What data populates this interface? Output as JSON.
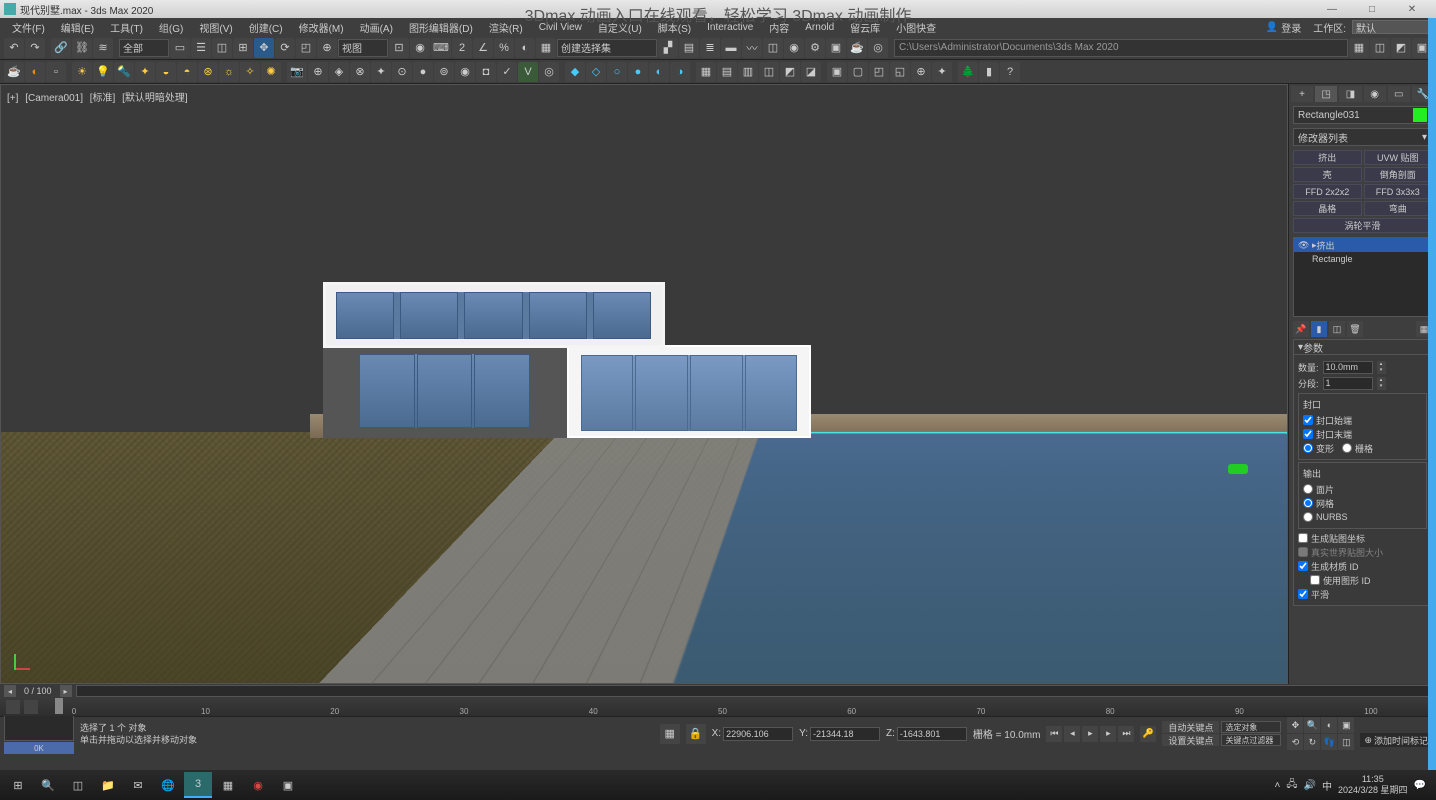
{
  "titlebar": {
    "filename": "现代别墅.max - 3ds Max 2020"
  },
  "overlay": "3Dmax 动画入口在线观看，轻松学习 3Dmax 动画制作",
  "menubar": {
    "items": [
      "文件(F)",
      "编辑(E)",
      "工具(T)",
      "组(G)",
      "视图(V)",
      "创建(C)",
      "修改器(M)",
      "动画(A)",
      "图形编辑器(D)",
      "渲染(R)",
      "Civil View",
      "自定义(U)",
      "脚本(S)",
      "Interactive",
      "内容",
      "Arnold",
      "留云库",
      "小图快查"
    ],
    "login": "登录",
    "workspace_label": "工作区:",
    "workspace_value": "默认"
  },
  "toolbar1": {
    "sel_filter": "全部",
    "view_mode": "视图",
    "path": "C:\\Users\\Administrator\\Documents\\3ds Max 2020"
  },
  "viewport": {
    "labels": [
      "[+]",
      "[Camera001]",
      "[标准]",
      "[默认明暗处理]"
    ]
  },
  "sidebar": {
    "object_name": "Rectangle031",
    "modifier_header": "修改器列表",
    "modifier_buttons": [
      {
        "l": "挤出",
        "r": "UVW 贴图"
      },
      {
        "l": "壳",
        "r": "倒角剖面"
      },
      {
        "l": "FFD 2x2x2",
        "r": "FFD 3x3x3"
      },
      {
        "l": "晶格",
        "r": "弯曲"
      }
    ],
    "modifier_single": "涡轮平滑",
    "stack": [
      {
        "name": "挤出",
        "selected": true
      },
      {
        "name": "Rectangle",
        "selected": false
      }
    ],
    "params_title": "参数",
    "amount_label": "数量:",
    "amount_value": "10.0mm",
    "segments_label": "分段:",
    "segments_value": "1",
    "cap_title": "封口",
    "cap_start": "封口始端",
    "cap_end": "封口末端",
    "morph": "变形",
    "grid": "栅格",
    "output_title": "输出",
    "patch": "面片",
    "mesh": "网格",
    "nurbs": "NURBS",
    "gen_map": "生成贴图坐标",
    "real_world": "真实世界贴图大小",
    "gen_mat_id": "生成材质 ID",
    "use_shape_id": "使用图形 ID",
    "smooth": "平滑"
  },
  "timeline": {
    "frame": "0 / 100",
    "ticks": [
      "0",
      "10",
      "20",
      "30",
      "40",
      "50",
      "60",
      "70",
      "80",
      "90",
      "100"
    ]
  },
  "status": {
    "maxscript": "0K",
    "sel_text": "选择了 1 个 对象",
    "hint_text": "单击并拖动以选择并移动对象",
    "x": "22906.106",
    "y": "-21344.18",
    "z": "-1643.801",
    "grid": "栅格 = 10.0mm",
    "add_time_tag": "添加时间标记",
    "auto_key": "自动关键点",
    "set_key": "设置关键点",
    "sel_obj": "选定对象",
    "key_filter": "关键点过滤器"
  },
  "taskbar": {
    "time": "11:35",
    "date": "2024/3/28 星期四",
    "ime": "中"
  }
}
